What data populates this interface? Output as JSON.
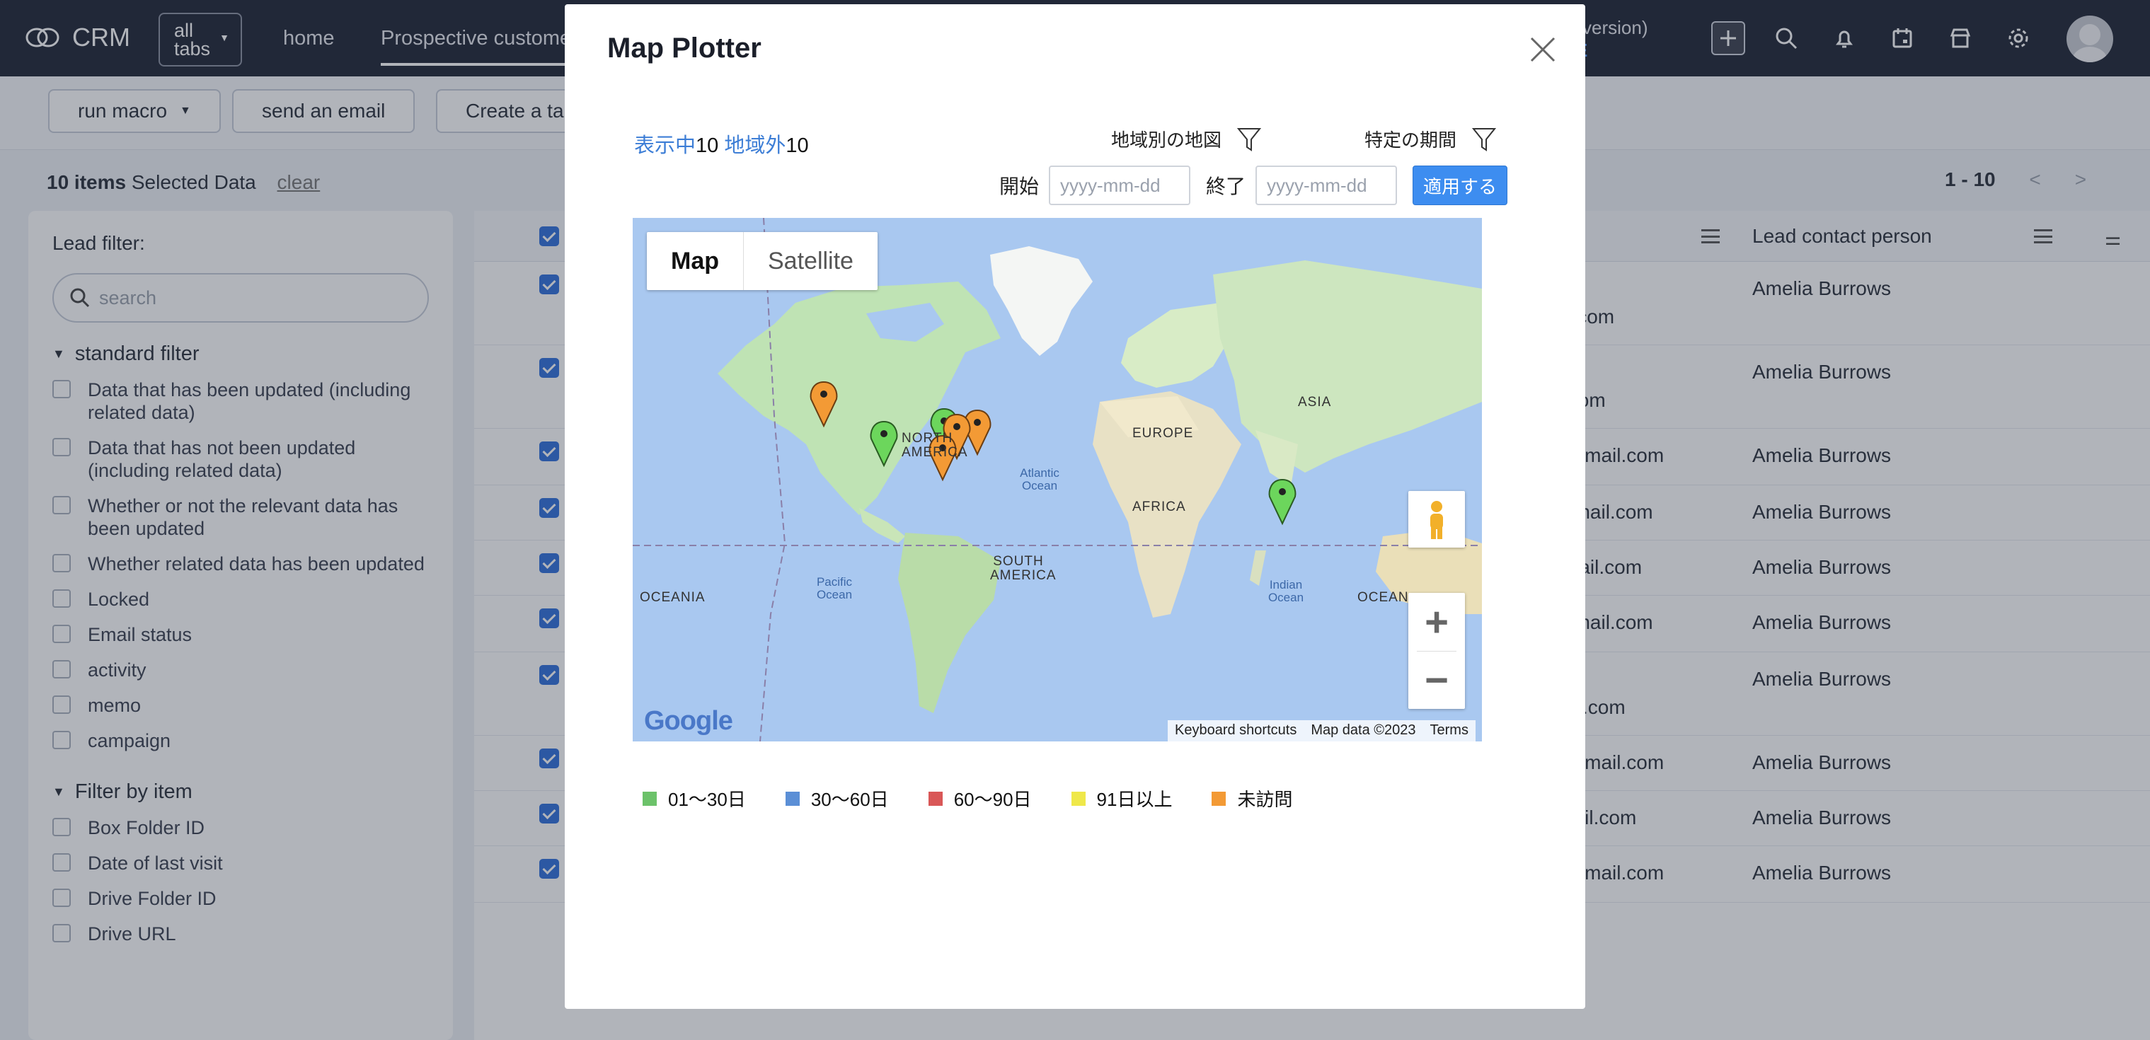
{
  "app": {
    "logo_text": "CRM",
    "all_tabs_label": "all\ntabs"
  },
  "nav": {
    "items": [
      "home",
      "Prospective customers"
    ],
    "trial_text": "version)",
    "trial_link": "E"
  },
  "toolbar": {
    "run_macro": "run macro",
    "send_email": "send an email",
    "create_task": "Create a ta"
  },
  "selection": {
    "count": "10 items",
    "label": "Selected Data",
    "clear": "clear"
  },
  "pager": {
    "range": "1 - 10",
    "prev": "<",
    "next": ">"
  },
  "sidebar": {
    "title": "Lead filter:",
    "search_placeholder": "search",
    "standard_title": "standard filter",
    "standard_items": [
      "Data that has been updated (including related data)",
      "Data that has not been updated (including related data)",
      "Whether or not the relevant data has been updated",
      "Whether related data has been updated",
      "Locked",
      "Email status",
      "activity",
      "memo",
      "campaign"
    ],
    "item_filter_title": "Filter by item",
    "item_filter_items": [
      "Box Folder ID",
      "Date of last visit",
      "Drive Folder ID",
      "Drive URL"
    ]
  },
  "table": {
    "col_contact": "Lead contact person",
    "rows": [
      {
        "email": "il.com",
        "person": "Amelia Burrows"
      },
      {
        "email": ".com",
        "person": "Amelia Burrows"
      },
      {
        "email": "oemail.com",
        "person": "Amelia Burrows"
      },
      {
        "email": "email.com",
        "person": "Amelia Burrows"
      },
      {
        "email": "mail.com",
        "person": "Amelia Burrows"
      },
      {
        "email": "email.com",
        "person": "Amelia Burrows"
      },
      {
        "email": "ail.com",
        "person": "Amelia Burrows"
      },
      {
        "email": "oemail.com",
        "person": "Amelia Burrows"
      },
      {
        "email": "nail.com",
        "person": "Amelia Burrows"
      },
      {
        "email": "oemail.com",
        "person": "Amelia Burrows"
      }
    ]
  },
  "modal": {
    "title": "Map Plotter",
    "shown_label": "表示中",
    "shown_count": "10",
    "out_label": "地域外",
    "out_count": "10",
    "region_filter": "地域別の地図",
    "period_filter": "特定の期間",
    "start_label": "開始",
    "end_label": "終了",
    "start_placeholder": "yyyy-mm-dd",
    "end_placeholder": "yyyy-mm-dd",
    "apply": "適用する",
    "map": {
      "type_map": "Map",
      "type_satellite": "Satellite",
      "keyboard": "Keyboard shortcuts",
      "mapdata": "Map data ©2023",
      "terms": "Terms",
      "google": "Google",
      "labels": {
        "north_america": "NORTH AMERICA",
        "south_america": "SOUTH AMERICA",
        "europe": "EUROPE",
        "africa": "AFRICA",
        "asia": "ASIA",
        "oceania_left": "OCEANIA",
        "oceania_right": "OCEAN",
        "atlantic": "Atlantic Ocean",
        "pacific": "Pacific Ocean",
        "indian": "Indian Ocean"
      }
    },
    "legend": [
      {
        "label": "01～30日",
        "color": "#6cc26a"
      },
      {
        "label": "30～60日",
        "color": "#5b8fd6"
      },
      {
        "label": "60～90日",
        "color": "#d95757"
      },
      {
        "label": "91日以上",
        "color": "#efe84a"
      },
      {
        "label": "未訪問",
        "color": "#f39a35"
      }
    ]
  }
}
